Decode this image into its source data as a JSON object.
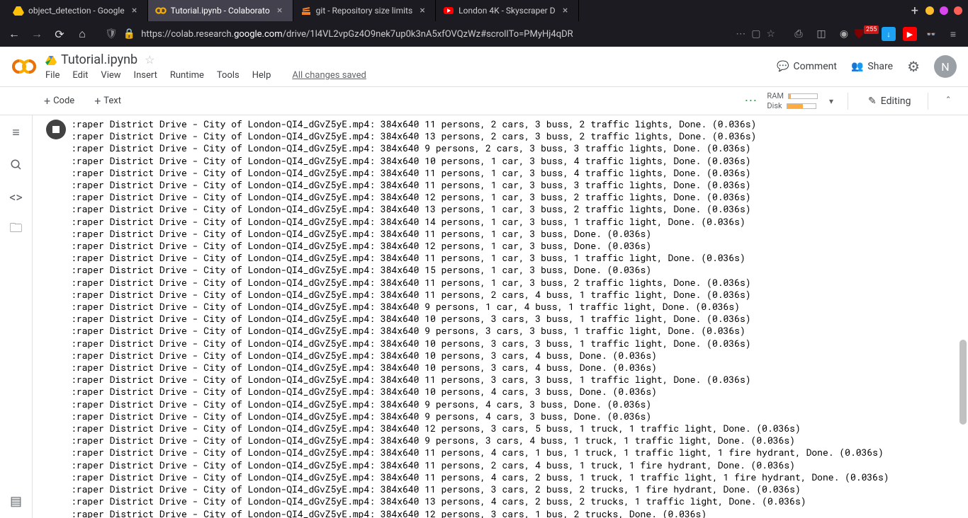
{
  "browser": {
    "tabs": [
      {
        "title": "object_detection - Google",
        "icon": "drive"
      },
      {
        "title": "Tutorial.ipynb - Colaborato",
        "icon": "colab",
        "active": true
      },
      {
        "title": "git - Repository size limits",
        "icon": "stack"
      },
      {
        "title": "London 4K - Skyscraper D",
        "icon": "youtube"
      }
    ],
    "url_prefix": "https://colab.research.",
    "url_domain": "google.com",
    "url_path": "/drive/1l4VL2vpGz4O9nek7up0k3nA5xfOVQzWz#scrollTo=PMyHj4qDR",
    "badge": "255"
  },
  "colab": {
    "notebook_title": "Tutorial.ipynb",
    "menus": [
      "File",
      "Edit",
      "View",
      "Insert",
      "Runtime",
      "Tools",
      "Help"
    ],
    "save_status": "All changes saved",
    "comment": "Comment",
    "share": "Share",
    "avatar_letter": "N",
    "add_code": "Code",
    "add_text": "Text",
    "ram_label": "RAM",
    "disk_label": "Disk",
    "ram_pct": 8,
    "disk_pct": 55,
    "editing": "Editing"
  },
  "output_lines": [
    ":raper District Drive - City of London-QI4_dGvZ5yE.mp4: 384x640 11 persons, 2 cars, 3 buss, 2 traffic lights, Done. (0.036s)",
    ":raper District Drive - City of London-QI4_dGvZ5yE.mp4: 384x640 13 persons, 2 cars, 3 buss, 2 traffic lights, Done. (0.036s)",
    ":raper District Drive - City of London-QI4_dGvZ5yE.mp4: 384x640 9 persons, 2 cars, 3 buss, 3 traffic lights, Done. (0.036s)",
    ":raper District Drive - City of London-QI4_dGvZ5yE.mp4: 384x640 10 persons, 1 car, 3 buss, 4 traffic lights, Done. (0.036s)",
    ":raper District Drive - City of London-QI4_dGvZ5yE.mp4: 384x640 11 persons, 1 car, 3 buss, 4 traffic lights, Done. (0.036s)",
    ":raper District Drive - City of London-QI4_dGvZ5yE.mp4: 384x640 11 persons, 1 car, 3 buss, 3 traffic lights, Done. (0.036s)",
    ":raper District Drive - City of London-QI4_dGvZ5yE.mp4: 384x640 12 persons, 1 car, 3 buss, 2 traffic lights, Done. (0.036s)",
    ":raper District Drive - City of London-QI4_dGvZ5yE.mp4: 384x640 13 persons, 1 car, 3 buss, 2 traffic lights, Done. (0.036s)",
    ":raper District Drive - City of London-QI4_dGvZ5yE.mp4: 384x640 14 persons, 1 car, 3 buss, 1 traffic light, Done. (0.036s)",
    ":raper District Drive - City of London-QI4_dGvZ5yE.mp4: 384x640 11 persons, 1 car, 3 buss, Done. (0.036s)",
    ":raper District Drive - City of London-QI4_dGvZ5yE.mp4: 384x640 12 persons, 1 car, 3 buss, Done. (0.036s)",
    ":raper District Drive - City of London-QI4_dGvZ5yE.mp4: 384x640 11 persons, 1 car, 3 buss, 1 traffic light, Done. (0.036s)",
    ":raper District Drive - City of London-QI4_dGvZ5yE.mp4: 384x640 15 persons, 1 car, 3 buss, Done. (0.036s)",
    ":raper District Drive - City of London-QI4_dGvZ5yE.mp4: 384x640 11 persons, 1 car, 3 buss, 2 traffic lights, Done. (0.036s)",
    ":raper District Drive - City of London-QI4_dGvZ5yE.mp4: 384x640 11 persons, 2 cars, 4 buss, 1 traffic light, Done. (0.036s)",
    ":raper District Drive - City of London-QI4_dGvZ5yE.mp4: 384x640 9 persons, 1 car, 4 buss, 1 traffic light, Done. (0.036s)",
    ":raper District Drive - City of London-QI4_dGvZ5yE.mp4: 384x640 10 persons, 3 cars, 3 buss, 1 traffic light, Done. (0.036s)",
    ":raper District Drive - City of London-QI4_dGvZ5yE.mp4: 384x640 9 persons, 3 cars, 3 buss, 1 traffic light, Done. (0.036s)",
    ":raper District Drive - City of London-QI4_dGvZ5yE.mp4: 384x640 10 persons, 3 cars, 3 buss, 1 traffic light, Done. (0.036s)",
    ":raper District Drive - City of London-QI4_dGvZ5yE.mp4: 384x640 10 persons, 3 cars, 4 buss, Done. (0.036s)",
    ":raper District Drive - City of London-QI4_dGvZ5yE.mp4: 384x640 10 persons, 3 cars, 4 buss, Done. (0.036s)",
    ":raper District Drive - City of London-QI4_dGvZ5yE.mp4: 384x640 11 persons, 3 cars, 3 buss, 1 traffic light, Done. (0.036s)",
    ":raper District Drive - City of London-QI4_dGvZ5yE.mp4: 384x640 10 persons, 4 cars, 3 buss, Done. (0.036s)",
    ":raper District Drive - City of London-QI4_dGvZ5yE.mp4: 384x640 9 persons, 4 cars, 3 buss, Done. (0.036s)",
    ":raper District Drive - City of London-QI4_dGvZ5yE.mp4: 384x640 9 persons, 4 cars, 3 buss, Done. (0.036s)",
    ":raper District Drive - City of London-QI4_dGvZ5yE.mp4: 384x640 12 persons, 3 cars, 5 buss, 1 truck, 1 traffic light, Done. (0.036s)",
    ":raper District Drive - City of London-QI4_dGvZ5yE.mp4: 384x640 9 persons, 3 cars, 4 buss, 1 truck, 1 traffic light, Done. (0.036s)",
    ":raper District Drive - City of London-QI4_dGvZ5yE.mp4: 384x640 11 persons, 4 cars, 1 bus, 1 truck, 1 traffic light, 1 fire hydrant, Done. (0.036s)",
    ":raper District Drive - City of London-QI4_dGvZ5yE.mp4: 384x640 11 persons, 2 cars, 4 buss, 1 truck, 1 fire hydrant, Done. (0.036s)",
    ":raper District Drive - City of London-QI4_dGvZ5yE.mp4: 384x640 11 persons, 4 cars, 2 buss, 1 truck, 1 traffic light, 1 fire hydrant, Done. (0.036s)",
    ":raper District Drive - City of London-QI4_dGvZ5yE.mp4: 384x640 11 persons, 3 cars, 2 buss, 2 trucks, 1 fire hydrant, Done. (0.036s)",
    ":raper District Drive - City of London-QI4_dGvZ5yE.mp4: 384x640 13 persons, 4 cars, 2 buss, 2 trucks, 1 traffic light, Done. (0.036s)",
    ":raper District Drive - City of London-QI4_dGvZ5yE.mp4: 384x640 12 persons, 3 cars, 1 bus, 2 trucks, Done. (0.036s)"
  ]
}
